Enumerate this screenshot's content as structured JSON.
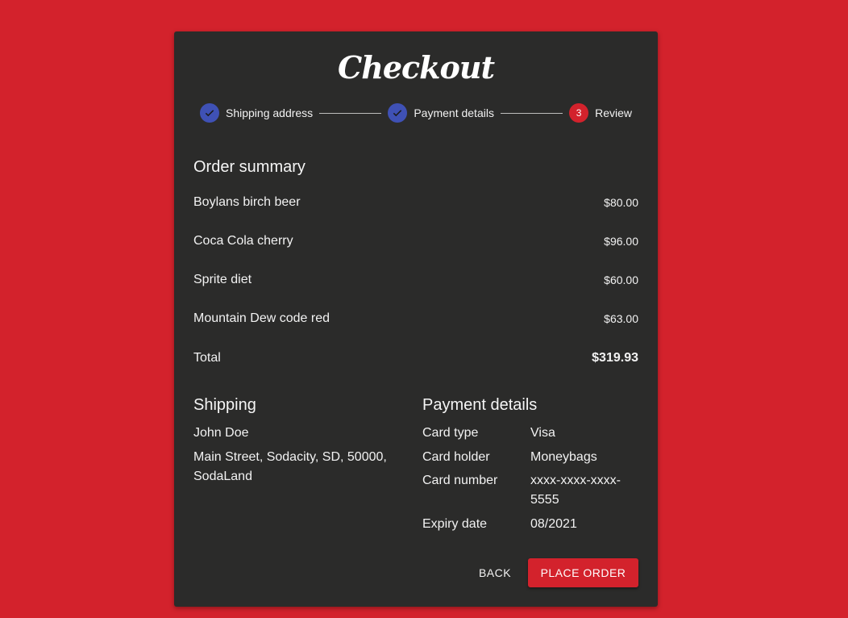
{
  "title": "Checkout",
  "stepper": {
    "steps": [
      {
        "label": "Shipping address",
        "state": "completed"
      },
      {
        "label": "Payment details",
        "state": "completed"
      },
      {
        "label": "Review",
        "state": "active",
        "number": "3"
      }
    ]
  },
  "order_summary": {
    "heading": "Order summary",
    "items": [
      {
        "name": "Boylans birch beer",
        "price": "$80.00"
      },
      {
        "name": "Coca Cola cherry",
        "price": "$96.00"
      },
      {
        "name": "Sprite diet",
        "price": "$60.00"
      },
      {
        "name": "Mountain Dew code red",
        "price": "$63.00"
      }
    ],
    "total_label": "Total",
    "total_value": "$319.93"
  },
  "shipping": {
    "heading": "Shipping",
    "name": "John Doe",
    "address_line1": "Main Street, Sodacity, SD, 50000,",
    "address_line2": "SodaLand"
  },
  "payment": {
    "heading": "Payment details",
    "rows": [
      {
        "label": "Card type",
        "value": "Visa"
      },
      {
        "label": "Card holder",
        "value": "Moneybags"
      },
      {
        "label": "Card number",
        "value_line1": "xxxx-xxxx-xxxx-",
        "value_line2": "5555"
      },
      {
        "label": "Expiry date",
        "value": "08/2021"
      }
    ]
  },
  "actions": {
    "back_label": "BACK",
    "place_order_label": "PLACE ORDER"
  },
  "colors": {
    "background": "#d3222c",
    "card": "#2b2b2a",
    "step_completed": "#3f51b5",
    "step_active": "#d3222c"
  }
}
